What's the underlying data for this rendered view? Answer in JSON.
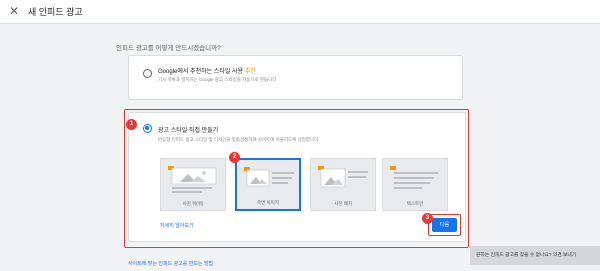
{
  "header": {
    "close_icon": "close-icon",
    "title": "새 인피드 광고"
  },
  "question": "인피드 광고를 어떻게 만드시겠습니까?",
  "options": {
    "google": {
      "title": "Google에서 추천하는 스타일 사용",
      "tag": "추천",
      "desc": "기사 목록과 일치하는 Google 광고 스타일을 자동으로 만듭니다"
    },
    "responsive": {
      "title": "광고 스타일 직접 만들기",
      "desc": "반응형 인피드 광고 스타일 및 디자인을 맞춤설정하여 사이트에 어울리도록 설정합니다"
    }
  },
  "tiles": [
    {
      "label": "사진 위(위)",
      "selected": false
    },
    {
      "label": "측면 이미지",
      "selected": true
    },
    {
      "label": "사진 배치",
      "selected": false
    },
    {
      "label": "텍스트만",
      "selected": false
    }
  ],
  "learn_more": "자세히 알아보기",
  "next_label": "다음",
  "badges": [
    "1",
    "2",
    "3"
  ],
  "bottom_link": "사이트에 맞는 인피드 광고를 만드는 방법",
  "feedback": "원하는 인피드 광고를 찾을 수 없나요? 의견 보내기",
  "colors": {
    "accent": "#1a73e8",
    "highlight": "#e53935",
    "tag": "#f29900"
  }
}
